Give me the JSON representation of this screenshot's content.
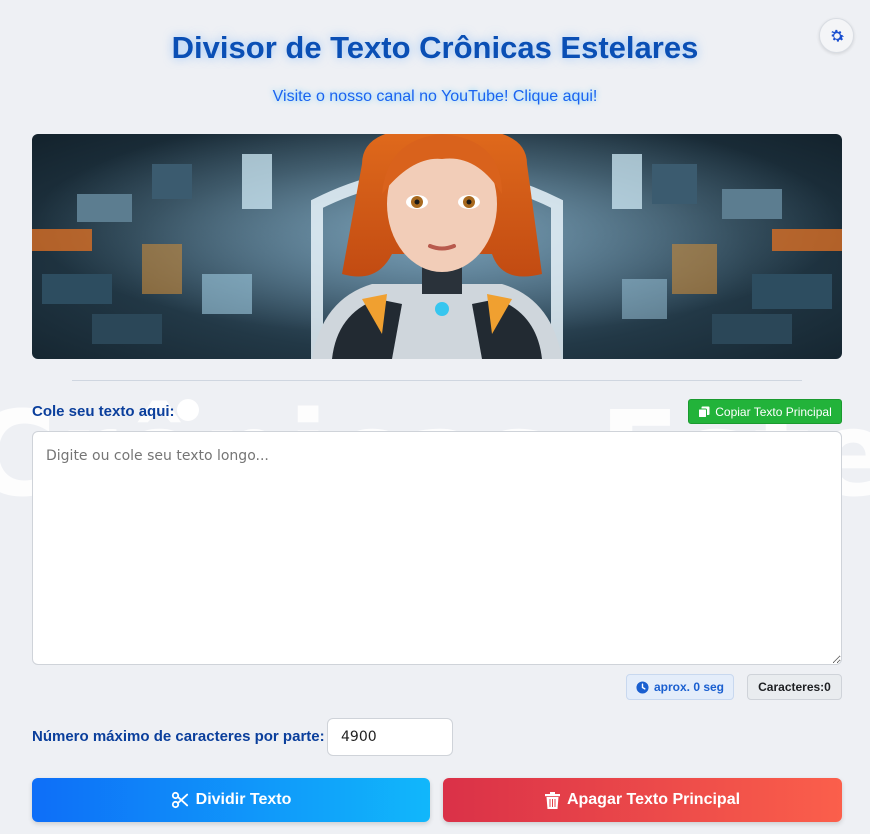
{
  "header": {
    "title": "Divisor de Texto Crônicas Estelares",
    "subtitle_link": "Visite o nosso canal no YouTube! Clique aqui!",
    "settings_icon": "gear-icon"
  },
  "watermark": "Crônicas Estelares",
  "editor": {
    "label": "Cole seu texto aqui:",
    "copy_button": "Copiar Texto Principal",
    "copy_icon": "copy-icon",
    "placeholder": "Digite ou cole seu texto longo...",
    "value": ""
  },
  "stats": {
    "time_label": "aprox. 0 seg",
    "time_icon": "clock-icon",
    "chars_label": "Caracteres:0"
  },
  "split_settings": {
    "label": "Número máximo de caracteres por parte:",
    "value": "4900"
  },
  "actions": {
    "split_label": "Dividir Texto",
    "split_icon": "scissors-icon",
    "clear_label": "Apagar Texto Principal",
    "clear_icon": "trash-icon"
  },
  "colors": {
    "title": "#0a4fb5",
    "accent_blue": "#0e6ef8",
    "accent_green": "#22b33a",
    "accent_red": "#da3148"
  }
}
